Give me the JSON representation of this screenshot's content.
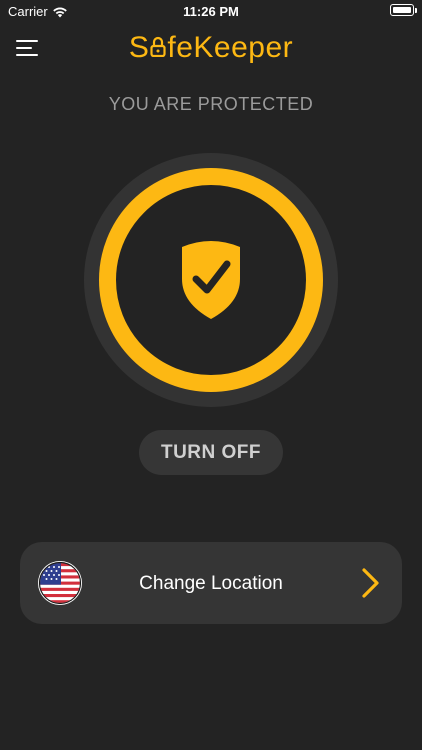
{
  "status_bar": {
    "carrier": "Carrier",
    "time": "11:26 PM",
    "wifi_icon": "wifi-icon",
    "battery_icon": "battery-icon"
  },
  "header": {
    "menu_icon": "hamburger-menu-icon",
    "logo_before": "S",
    "logo_after": "feKeeper",
    "logo_lock_icon": "padlock-icon"
  },
  "main": {
    "status_text": "YOU ARE PROTECTED",
    "shield_icon": "shield-check-icon",
    "turn_off_label": "TURN OFF"
  },
  "location": {
    "label": "Change Location",
    "flag_icon": "us-flag-icon",
    "chevron_icon": "chevron-right-icon"
  },
  "colors": {
    "background": "#232323",
    "accent": "#FDB813",
    "card": "#353535",
    "muted_text": "#9b9b9b"
  }
}
